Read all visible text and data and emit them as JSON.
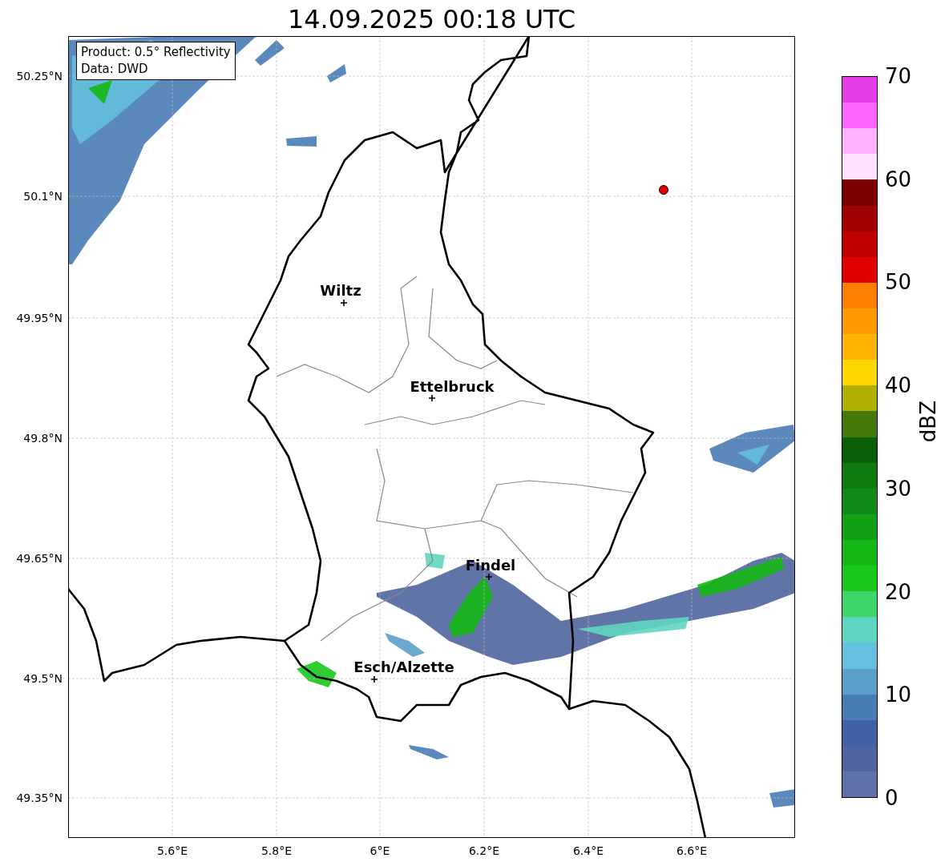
{
  "title": "14.09.2025 00:18 UTC",
  "map": {
    "info_lines": [
      "Product: 0.5° Reflectivity",
      "Data: DWD"
    ],
    "cities": [
      {
        "name": "Wiltz"
      },
      {
        "name": "Ettelbruck"
      },
      {
        "name": "Findel"
      },
      {
        "name": "Esch/Alzette"
      }
    ],
    "y_ticks": [
      "50.25°N",
      "50.1°N",
      "49.95°N",
      "49.8°N",
      "49.65°N",
      "49.5°N",
      "49.35°N"
    ],
    "x_ticks": [
      "5.6°E",
      "5.8°E",
      "6°E",
      "6.2°E",
      "6.4°E",
      "6.6°E"
    ]
  },
  "colorbar": {
    "label": "dBZ",
    "ticks": [
      "70",
      "60",
      "50",
      "40",
      "30",
      "20",
      "10",
      "0"
    ],
    "segments": [
      {
        "color": "#e83be8"
      },
      {
        "color": "#ff66ff"
      },
      {
        "color": "#ffb3ff"
      },
      {
        "color": "#ffe0ff"
      },
      {
        "color": "#7a0000"
      },
      {
        "color": "#a00000"
      },
      {
        "color": "#c00000"
      },
      {
        "color": "#e00000"
      },
      {
        "color": "#ff7f00"
      },
      {
        "color": "#ff9900"
      },
      {
        "color": "#ffb300"
      },
      {
        "color": "#ffd700"
      },
      {
        "color": "#b0b000"
      },
      {
        "color": "#457a0a"
      },
      {
        "color": "#0a5f0a"
      },
      {
        "color": "#0e7a10"
      },
      {
        "color": "#10881a"
      },
      {
        "color": "#12a015"
      },
      {
        "color": "#14b814"
      },
      {
        "color": "#18c81a"
      },
      {
        "color": "#3dd66a"
      },
      {
        "color": "#5fd6c0"
      },
      {
        "color": "#64c0dc"
      },
      {
        "color": "#5aa0c8"
      },
      {
        "color": "#4a7cb4"
      },
      {
        "color": "#4060a8"
      },
      {
        "color": "#50659f"
      },
      {
        "color": "#6070a8"
      }
    ]
  }
}
